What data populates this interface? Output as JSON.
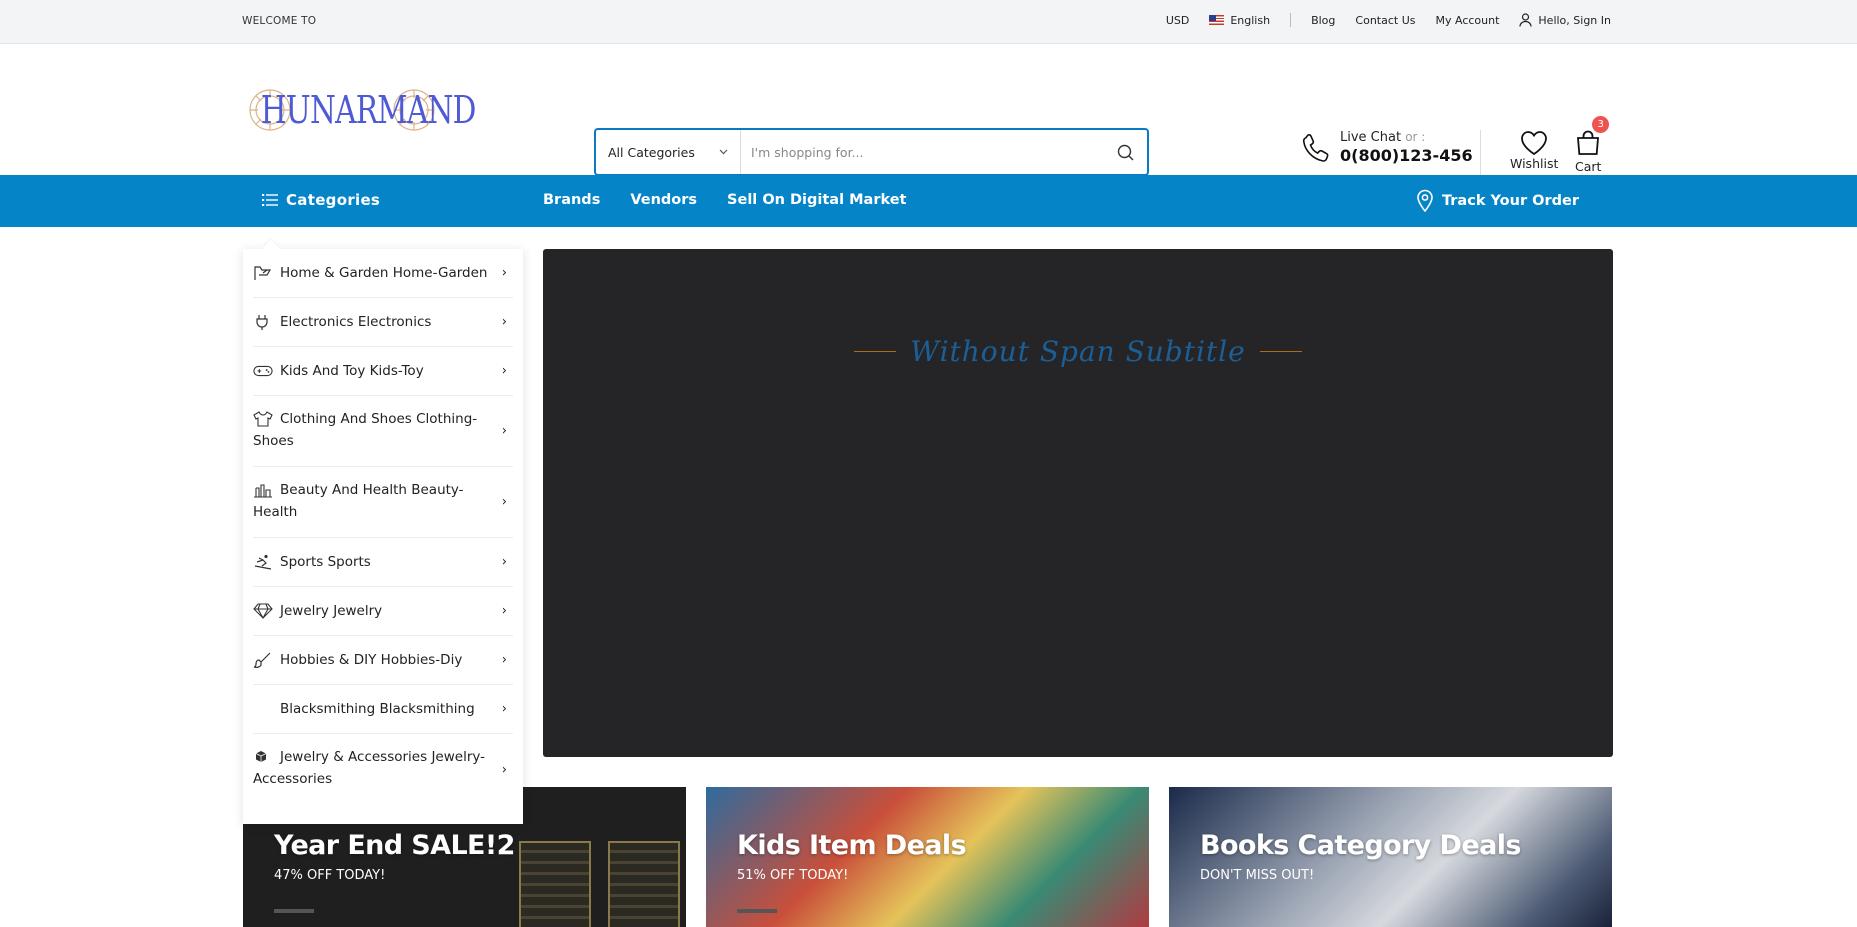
{
  "topbar": {
    "welcome": "WELCOME TO",
    "currency": "USD",
    "language": "English",
    "links": {
      "blog": "Blog",
      "contact": "Contact Us",
      "account": "My Account"
    },
    "signin": "Hello, Sign In"
  },
  "logo": {
    "text": "HUNARMAND"
  },
  "search": {
    "category": "All Categories",
    "placeholder": "I'm shopping for..."
  },
  "contact": {
    "label": "Live Chat",
    "or": "or :",
    "phone": "0(800)123-456"
  },
  "wishlist": {
    "label": "Wishlist"
  },
  "cart": {
    "label": "Cart",
    "count": "3"
  },
  "nav": {
    "categories": "Categories",
    "links": [
      "Brands",
      "Vendors",
      "Sell On Digital Market"
    ],
    "track": "Track Your Order"
  },
  "categories": [
    {
      "label": "Home & Garden Home-Garden",
      "icon": "home-garden-icon"
    },
    {
      "label": "Electronics Electronics",
      "icon": "plug-icon"
    },
    {
      "label": "Kids And Toy Kids-Toy",
      "icon": "gamepad-icon"
    },
    {
      "label": "Clothing And Shoes Clothing-Shoes",
      "icon": "tshirt-icon"
    },
    {
      "label": "Beauty And Health Beauty-Health",
      "icon": "beauty-icon"
    },
    {
      "label": "Sports Sports",
      "icon": "ski-icon"
    },
    {
      "label": "Jewelry Jewelry",
      "icon": "diamond-icon"
    },
    {
      "label": "Hobbies & DIY Hobbies-Diy",
      "icon": "brush-icon"
    },
    {
      "label": "Blacksmithing Blacksmithing",
      "icon": ""
    },
    {
      "label": "Jewelry & Accessories Jewelry-Accessories",
      "icon": "cube-icon"
    }
  ],
  "banner": {
    "subtitle": "Without Span Subtitle"
  },
  "promos": [
    {
      "title": "Year End SALE!2",
      "subtitle": "47% OFF TODAY!"
    },
    {
      "title": "Kids Item Deals",
      "subtitle": "51% OFF TODAY!"
    },
    {
      "title": "Books Category Deals",
      "subtitle": "DON'T MISS OUT!"
    }
  ],
  "colors": {
    "primary": "#0585c8",
    "badge": "#ef5350",
    "banner": "#252527",
    "subtitle": "#1b5f96"
  }
}
